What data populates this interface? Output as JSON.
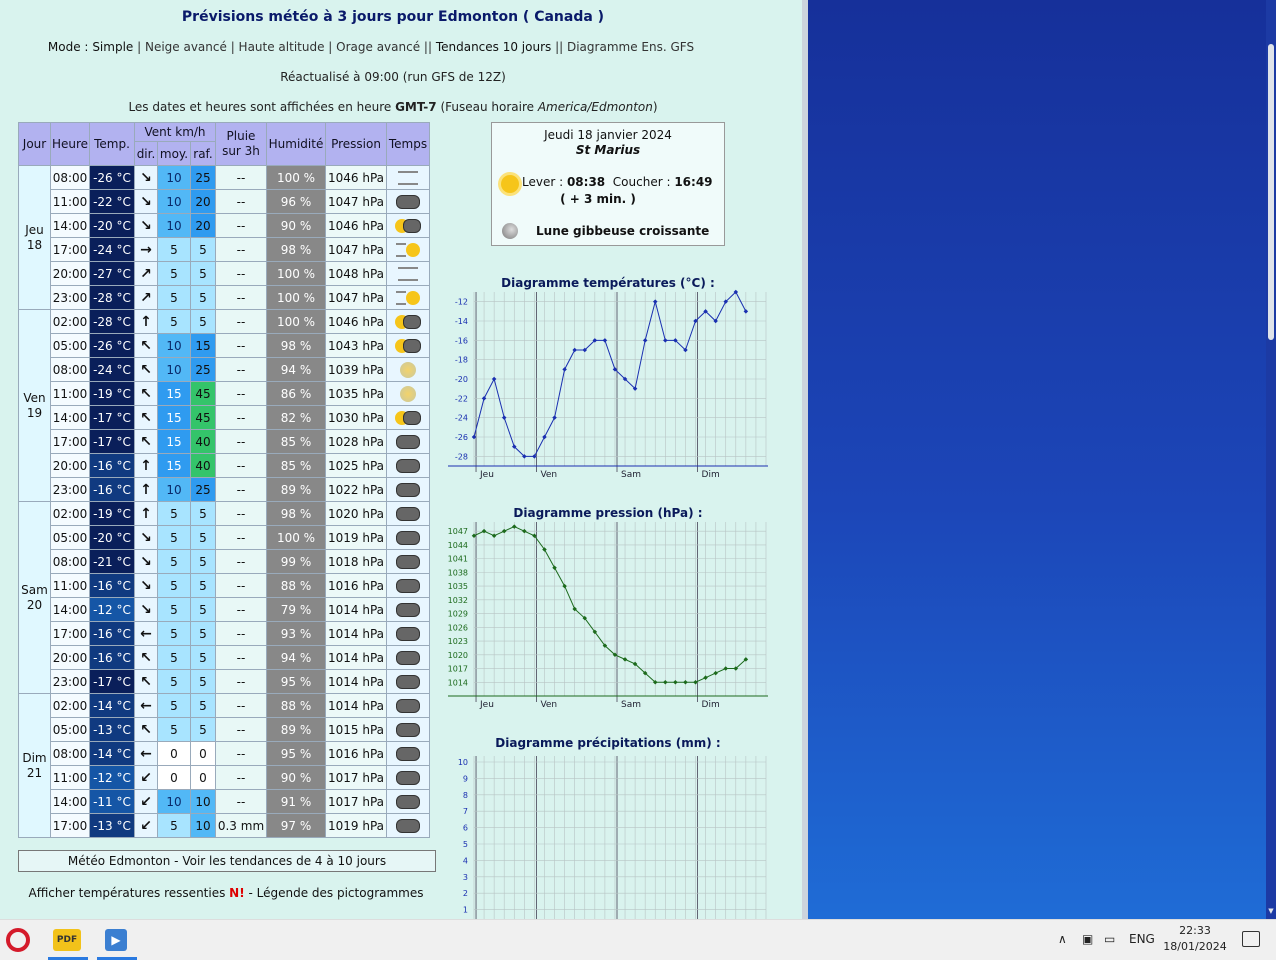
{
  "page": {
    "title": "Prévisions météo à 3 jours pour Edmonton ( Canada )",
    "mode_label": "Mode :",
    "modes": [
      "Simple",
      "Neige avancé",
      "Haute altitude",
      "Orage avancé",
      "Tendances 10 jours",
      "Diagramme Ens. GFS"
    ],
    "refresh": "Réactualisé à 09:00 (run GFS de 12Z)",
    "tz_prefix": "Les dates et heures sont affichées en heure ",
    "tz_gmt": "GMT-7",
    "tz_mid": " (Fuseau horaire ",
    "tz_name": "America/Edmonton",
    "tz_suffix": ")"
  },
  "table": {
    "headers": {
      "jour": "Jour",
      "heure": "Heure",
      "temp": "Temp.",
      "vent": "Vent km/h",
      "dir": "dir.",
      "moy": "moy.",
      "raf": "raf.",
      "pluie1": "Pluie",
      "pluie2": "sur 3h",
      "humidite": "Humidité",
      "pression": "Pression",
      "temps": "Temps"
    },
    "days": [
      {
        "name": "Jeu",
        "num": "18",
        "rows": 6
      },
      {
        "name": "Ven",
        "num": "19",
        "rows": 8
      },
      {
        "name": "Sam",
        "num": "20",
        "rows": 8
      },
      {
        "name": "Dim",
        "num": "21",
        "rows": 6
      }
    ],
    "rows": [
      {
        "h": "08:00",
        "t": "-26 °C",
        "d": "↘",
        "m": "10",
        "r": "25",
        "p": "--",
        "u": "100 %",
        "pr": "1046 hPa",
        "w": "fog"
      },
      {
        "h": "11:00",
        "t": "-22 °C",
        "d": "↘",
        "m": "10",
        "r": "20",
        "p": "--",
        "u": "96 %",
        "pr": "1047 hPa",
        "w": "cloud"
      },
      {
        "h": "14:00",
        "t": "-20 °C",
        "d": "↘",
        "m": "10",
        "r": "20",
        "p": "--",
        "u": "90 %",
        "pr": "1046 hPa",
        "w": "suncloud"
      },
      {
        "h": "17:00",
        "t": "-24 °C",
        "d": "→",
        "m": "5",
        "r": "5",
        "p": "--",
        "u": "98 %",
        "pr": "1047 hPa",
        "w": "sunfog"
      },
      {
        "h": "20:00",
        "t": "-27 °C",
        "d": "↗",
        "m": "5",
        "r": "5",
        "p": "--",
        "u": "100 %",
        "pr": "1048 hPa",
        "w": "fog"
      },
      {
        "h": "23:00",
        "t": "-28 °C",
        "d": "↗",
        "m": "5",
        "r": "5",
        "p": "--",
        "u": "100 %",
        "pr": "1047 hPa",
        "w": "sunfog"
      },
      {
        "h": "02:00",
        "t": "-28 °C",
        "d": "↑",
        "m": "5",
        "r": "5",
        "p": "--",
        "u": "100 %",
        "pr": "1046 hPa",
        "w": "suncloud"
      },
      {
        "h": "05:00",
        "t": "-26 °C",
        "d": "↖",
        "m": "10",
        "r": "15",
        "p": "--",
        "u": "98 %",
        "pr": "1043 hPa",
        "w": "suncloud"
      },
      {
        "h": "08:00",
        "t": "-24 °C",
        "d": "↖",
        "m": "10",
        "r": "25",
        "p": "--",
        "u": "94 %",
        "pr": "1039 hPa",
        "w": "haze"
      },
      {
        "h": "11:00",
        "t": "-19 °C",
        "d": "↖",
        "m": "15",
        "r": "45",
        "p": "--",
        "u": "86 %",
        "pr": "1035 hPa",
        "w": "haze"
      },
      {
        "h": "14:00",
        "t": "-17 °C",
        "d": "↖",
        "m": "15",
        "r": "45",
        "p": "--",
        "u": "82 %",
        "pr": "1030 hPa",
        "w": "suncloud"
      },
      {
        "h": "17:00",
        "t": "-17 °C",
        "d": "↖",
        "m": "15",
        "r": "40",
        "p": "--",
        "u": "85 %",
        "pr": "1028 hPa",
        "w": "cloud"
      },
      {
        "h": "20:00",
        "t": "-16 °C",
        "d": "↑",
        "m": "15",
        "r": "40",
        "p": "--",
        "u": "85 %",
        "pr": "1025 hPa",
        "w": "cloud"
      },
      {
        "h": "23:00",
        "t": "-16 °C",
        "d": "↑",
        "m": "10",
        "r": "25",
        "p": "--",
        "u": "89 %",
        "pr": "1022 hPa",
        "w": "cloud"
      },
      {
        "h": "02:00",
        "t": "-19 °C",
        "d": "↑",
        "m": "5",
        "r": "5",
        "p": "--",
        "u": "98 %",
        "pr": "1020 hPa",
        "w": "cloud"
      },
      {
        "h": "05:00",
        "t": "-20 °C",
        "d": "↘",
        "m": "5",
        "r": "5",
        "p": "--",
        "u": "100 %",
        "pr": "1019 hPa",
        "w": "cloud"
      },
      {
        "h": "08:00",
        "t": "-21 °C",
        "d": "↘",
        "m": "5",
        "r": "5",
        "p": "--",
        "u": "99 %",
        "pr": "1018 hPa",
        "w": "cloud"
      },
      {
        "h": "11:00",
        "t": "-16 °C",
        "d": "↘",
        "m": "5",
        "r": "5",
        "p": "--",
        "u": "88 %",
        "pr": "1016 hPa",
        "w": "cloud"
      },
      {
        "h": "14:00",
        "t": "-12 °C",
        "d": "↘",
        "m": "5",
        "r": "5",
        "p": "--",
        "u": "79 %",
        "pr": "1014 hPa",
        "w": "cloud"
      },
      {
        "h": "17:00",
        "t": "-16 °C",
        "d": "←",
        "m": "5",
        "r": "5",
        "p": "--",
        "u": "93 %",
        "pr": "1014 hPa",
        "w": "cloud"
      },
      {
        "h": "20:00",
        "t": "-16 °C",
        "d": "↖",
        "m": "5",
        "r": "5",
        "p": "--",
        "u": "94 %",
        "pr": "1014 hPa",
        "w": "cloud"
      },
      {
        "h": "23:00",
        "t": "-17 °C",
        "d": "↖",
        "m": "5",
        "r": "5",
        "p": "--",
        "u": "95 %",
        "pr": "1014 hPa",
        "w": "cloud"
      },
      {
        "h": "02:00",
        "t": "-14 °C",
        "d": "←",
        "m": "5",
        "r": "5",
        "p": "--",
        "u": "88 %",
        "pr": "1014 hPa",
        "w": "cloud"
      },
      {
        "h": "05:00",
        "t": "-13 °C",
        "d": "↖",
        "m": "5",
        "r": "5",
        "p": "--",
        "u": "89 %",
        "pr": "1015 hPa",
        "w": "cloud"
      },
      {
        "h": "08:00",
        "t": "-14 °C",
        "d": "←",
        "m": "0",
        "r": "0",
        "p": "--",
        "u": "95 %",
        "pr": "1016 hPa",
        "w": "cloud"
      },
      {
        "h": "11:00",
        "t": "-12 °C",
        "d": "↙",
        "m": "0",
        "r": "0",
        "p": "--",
        "u": "90 %",
        "pr": "1017 hPa",
        "w": "cloud"
      },
      {
        "h": "14:00",
        "t": "-11 °C",
        "d": "↙",
        "m": "10",
        "r": "10",
        "p": "--",
        "u": "91 %",
        "pr": "1017 hPa",
        "w": "cloud"
      },
      {
        "h": "17:00",
        "t": "-13 °C",
        "d": "↙",
        "m": "5",
        "r": "10",
        "p": "0.3 mm",
        "u": "97 %",
        "pr": "1019 hPa",
        "w": "cloud"
      }
    ]
  },
  "links": {
    "tendances": "Météo Edmonton - Voir les tendances de 4 à 10 jours",
    "ressenti_a": "Afficher températures ressenties ",
    "ressenti_n": "N!",
    "ressenti_b": " - Légende des pictogrammes"
  },
  "sunbox": {
    "date": "Jeudi 18 janvier 2024",
    "saint": "St Marius",
    "lever_label": "Lever : ",
    "lever": "08:38",
    "coucher_label": "Coucher : ",
    "coucher": "16:49",
    "plus": "( + 3 min. )",
    "moon": "Lune gibbeuse croissante"
  },
  "colors": {
    "temp_dark": "#0a1f5a",
    "temp_mid": "#1556a6",
    "wind_low": "#a8e4ff",
    "wind_mid": "#2f9bf0",
    "wind_high": "#34c46a",
    "temp_line": "#1a2fb0",
    "pres_line": "#1c6a1c"
  },
  "chart_data": [
    {
      "type": "line",
      "title": "Diagramme températures (°C) :",
      "x": [
        "08:00",
        "11:00",
        "14:00",
        "17:00",
        "20:00",
        "23:00",
        "02:00",
        "05:00",
        "08:00",
        "11:00",
        "14:00",
        "17:00",
        "20:00",
        "23:00",
        "02:00",
        "05:00",
        "08:00",
        "11:00",
        "14:00",
        "17:00",
        "20:00",
        "23:00",
        "02:00",
        "05:00",
        "08:00",
        "11:00",
        "14:00",
        "17:00"
      ],
      "values": [
        -26,
        -22,
        -20,
        -24,
        -27,
        -28,
        -28,
        -26,
        -24,
        -19,
        -17,
        -17,
        -16,
        -16,
        -19,
        -20,
        -21,
        -16,
        -12,
        -16,
        -16,
        -17,
        -14,
        -13,
        -14,
        -12,
        -11,
        -13
      ],
      "yticks": [
        -12,
        -14,
        -16,
        -18,
        -20,
        -22,
        -24,
        -26,
        -28
      ],
      "ylim": [
        -29,
        -11
      ],
      "day_labels": [
        "Jeu",
        "Ven",
        "Sam",
        "Dim"
      ]
    },
    {
      "type": "line",
      "title": "Diagramme pression (hPa) :",
      "x": [
        "08:00",
        "11:00",
        "14:00",
        "17:00",
        "20:00",
        "23:00",
        "02:00",
        "05:00",
        "08:00",
        "11:00",
        "14:00",
        "17:00",
        "20:00",
        "23:00",
        "02:00",
        "05:00",
        "08:00",
        "11:00",
        "14:00",
        "17:00",
        "20:00",
        "23:00",
        "02:00",
        "05:00",
        "08:00",
        "11:00",
        "14:00",
        "17:00"
      ],
      "values": [
        1046,
        1047,
        1046,
        1047,
        1048,
        1047,
        1046,
        1043,
        1039,
        1035,
        1030,
        1028,
        1025,
        1022,
        1020,
        1019,
        1018,
        1016,
        1014,
        1014,
        1014,
        1014,
        1014,
        1015,
        1016,
        1017,
        1017,
        1019
      ],
      "yticks": [
        1047,
        1044,
        1041,
        1038,
        1035,
        1032,
        1029,
        1026,
        1023,
        1020,
        1017,
        1014
      ],
      "ylim": [
        1011,
        1049
      ],
      "day_labels": [
        "Jeu",
        "Ven",
        "Sam",
        "Dim"
      ]
    },
    {
      "type": "bar",
      "title": "Diagramme précipitations (mm) :",
      "yticks": [
        10,
        9,
        8,
        7,
        6,
        5,
        4,
        3,
        2,
        1
      ],
      "ylim": [
        0,
        10
      ]
    }
  ],
  "taskbar": {
    "app1": "PDF",
    "app2": "▶",
    "chev": "∧",
    "lang": "ENG",
    "time": "22:33",
    "date": "18/01/2024"
  }
}
